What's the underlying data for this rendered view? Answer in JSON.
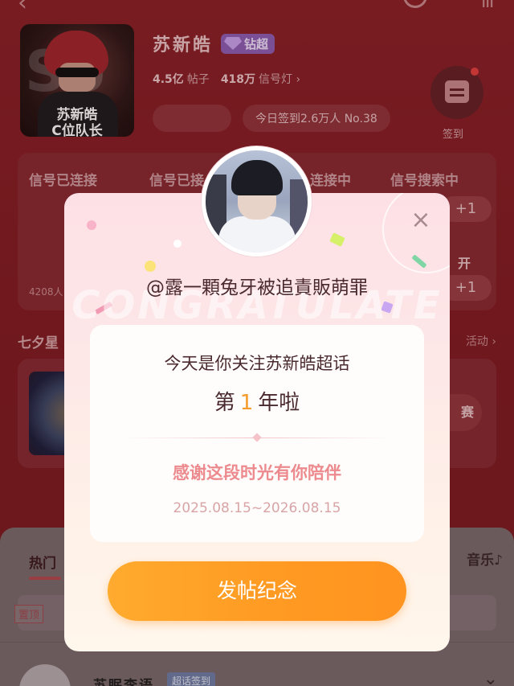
{
  "header": {
    "title": "苏新皓",
    "super_badge": "钻超",
    "posts_value": "4.5亿",
    "posts_label": "帖子",
    "signal_value": "418万",
    "signal_label": "信号灯",
    "signal_arrow": "›",
    "checkin_summary": "今日签到2.6万人 No.38",
    "checkin_label": "签到",
    "cover_caption_line1": "苏新皓",
    "cover_caption_line2": "C位队长"
  },
  "signals": {
    "col1": "信号已连接",
    "col2": "信号已接",
    "col3": "连接中",
    "col4": "信号搜索中",
    "plus1": "+1",
    "plus2": "+1",
    "open_text": "开",
    "count_text": "4208人"
  },
  "section": {
    "title": "七夕星",
    "action": "活动 ›",
    "event_button": "赛"
  },
  "sheet": {
    "tab_hot": "热门",
    "tab_music": "音乐♪",
    "pinned": "置顶",
    "username": "苏眠李语",
    "user_badge": "超话签到"
  },
  "dialog": {
    "close": "×",
    "watermark": "CONGRATULATE",
    "username": "@露一顆兔牙被追責販萌罪",
    "line1": "今天是你关注苏新皓超话",
    "line2_prefix": "第",
    "line2_number": "1",
    "line2_suffix": "年啦",
    "thanks": "感谢这段时光有你陪伴",
    "dates": "2025.08.15~2026.08.15",
    "post_button": "发帖纪念"
  },
  "colors": {
    "page_background": "#7e1c22",
    "dialog_button": "#ff9a22",
    "year_number": "#f49b2c",
    "thanks_text": "#ec8a8e"
  }
}
